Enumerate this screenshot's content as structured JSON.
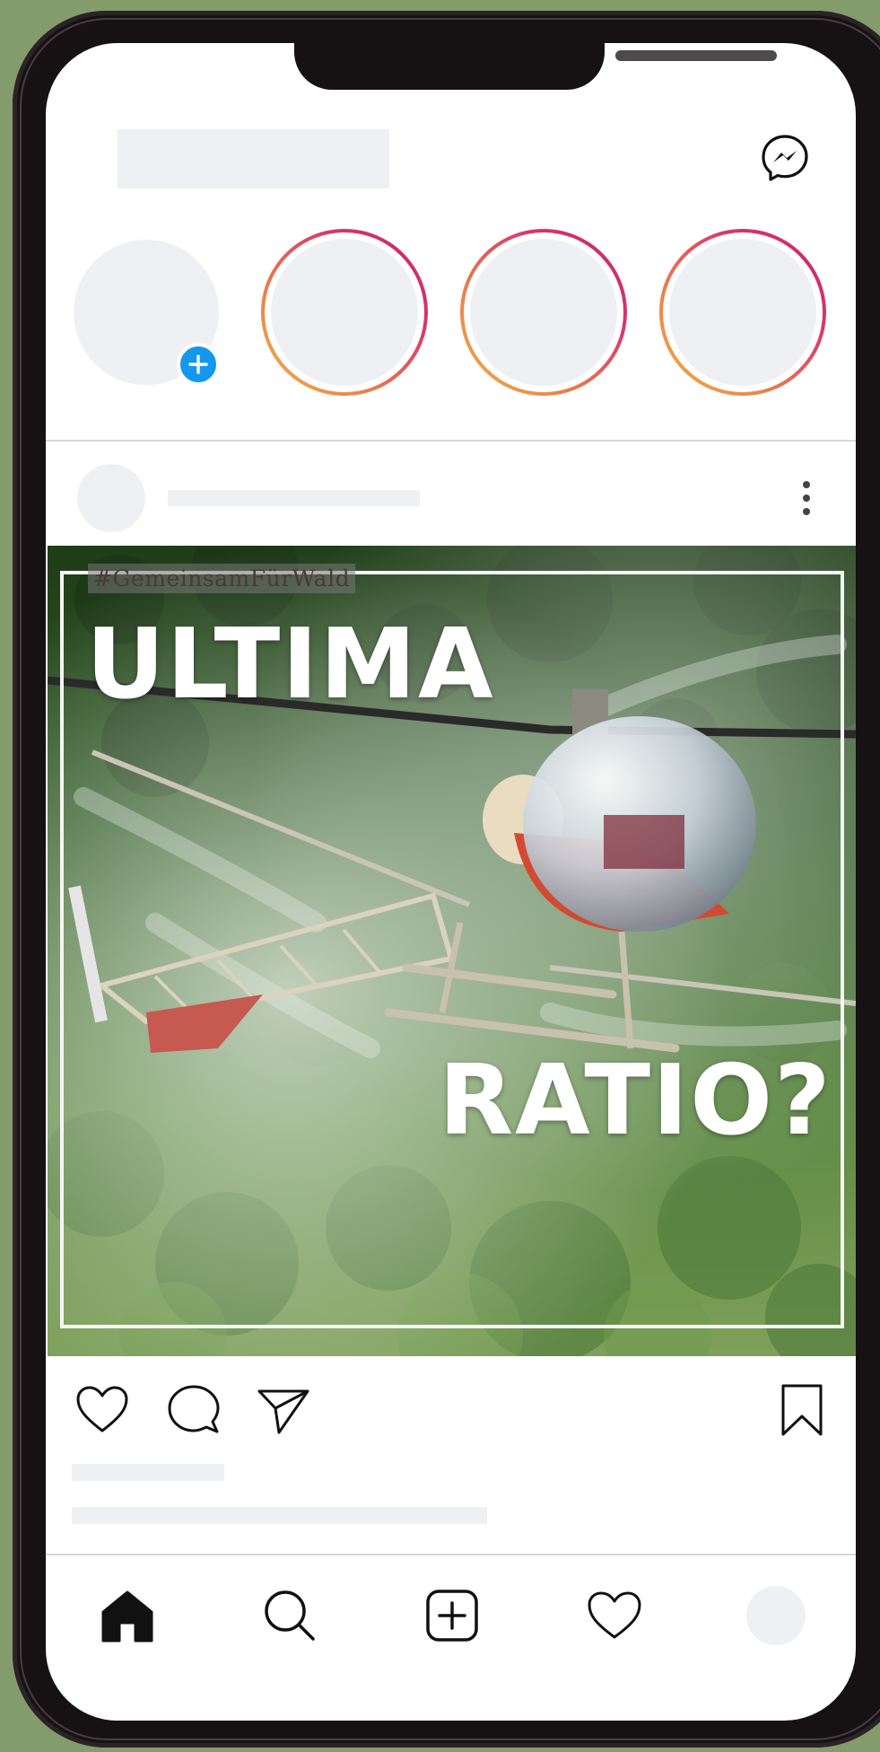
{
  "post": {
    "hashtag": "#GemeinsamFürWald",
    "headline_1": "ULTIMA",
    "headline_2": "RATIO?",
    "image_subject": "crop-spraying helicopter over forest"
  },
  "icons": {
    "messenger": "messenger-icon",
    "add_story": "plus-icon",
    "more": "more-vertical-icon",
    "like": "heart-icon",
    "comment": "comment-icon",
    "share": "send-icon",
    "save": "bookmark-icon",
    "home": "home-icon",
    "search": "search-icon",
    "create": "add-square-icon",
    "activity": "heart-icon"
  },
  "colors": {
    "background": "#849c6c",
    "frame": "#161113",
    "placeholder": "#eff0f3",
    "add_story_blue": "#1398ee",
    "story_ring_start": "#f2b448",
    "story_ring_end": "#c8236f"
  }
}
